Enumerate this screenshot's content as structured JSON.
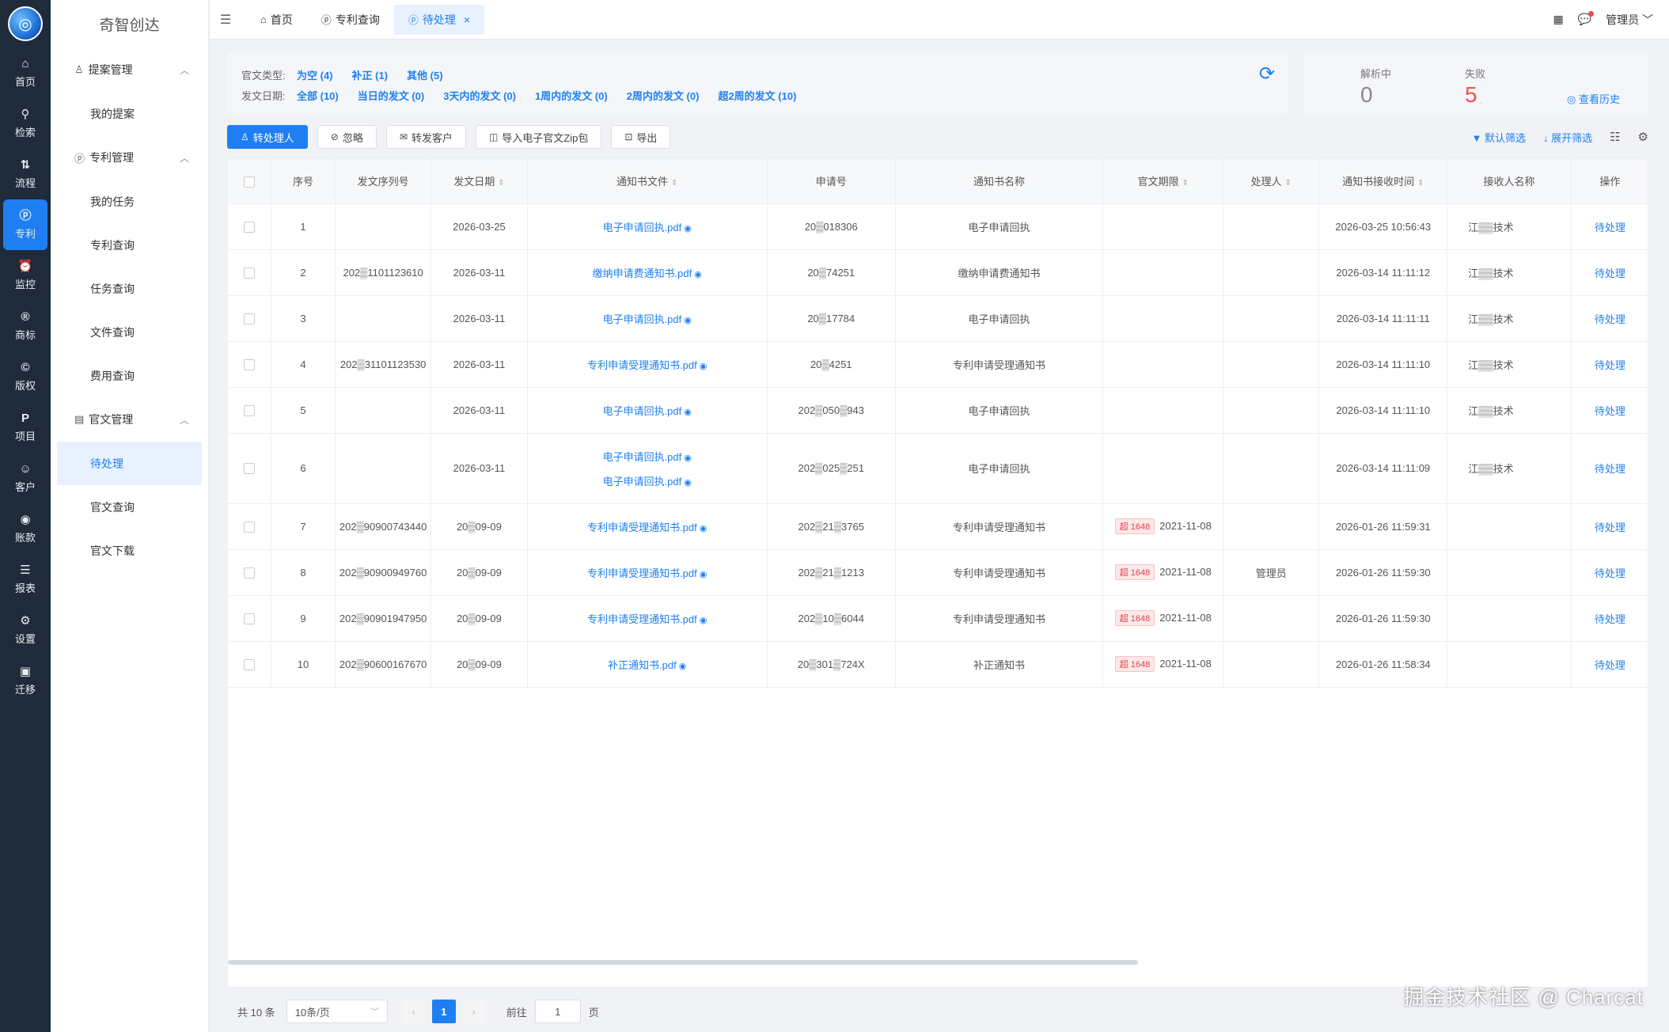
{
  "app": {
    "name": "奇智创达",
    "logo_glyph": "◎"
  },
  "rail": [
    {
      "icon": "⌂",
      "icon_name": "home-icon",
      "label": "首页"
    },
    {
      "icon": "⚲",
      "icon_name": "search-icon",
      "label": "检索"
    },
    {
      "icon": "⇅",
      "icon_name": "flow-icon",
      "label": "流程"
    },
    {
      "icon": "ⓟ",
      "icon_name": "patent-icon",
      "label": "专利"
    },
    {
      "icon": "⏰",
      "icon_name": "alarm-icon",
      "label": "监控"
    },
    {
      "icon": "®",
      "icon_name": "trademark-icon",
      "label": "商标"
    },
    {
      "icon": "©",
      "icon_name": "copyright-icon",
      "label": "版权"
    },
    {
      "icon": "P",
      "icon_name": "project-icon",
      "label": "项目"
    },
    {
      "icon": "☺",
      "icon_name": "user-icon",
      "label": "客户"
    },
    {
      "icon": "◉",
      "icon_name": "account-icon",
      "label": "账款"
    },
    {
      "icon": "☰",
      "icon_name": "report-icon",
      "label": "报表"
    },
    {
      "icon": "⚙",
      "icon_name": "gear-icon",
      "label": "设置"
    },
    {
      "icon": "▣",
      "icon_name": "migrate-icon",
      "label": "迁移"
    }
  ],
  "sidebar": {
    "groups": [
      {
        "icon": "♙",
        "label": "提案管理",
        "chev": "︿",
        "items": [
          "我的提案"
        ]
      },
      {
        "icon": "ⓟ",
        "label": "专利管理",
        "chev": "︿",
        "items": [
          "我的任务",
          "专利查询",
          "任务查询",
          "文件查询",
          "费用查询"
        ]
      },
      {
        "icon": "▤",
        "label": "官文管理",
        "chev": "︿",
        "items": [
          "待处理",
          "官文查询",
          "官文下载"
        ]
      }
    ]
  },
  "topbar": {
    "collapse_glyph": "☰",
    "tabs": [
      {
        "icon": "⌂",
        "label": "首页"
      },
      {
        "icon": "ⓟ",
        "label": "专利查询"
      },
      {
        "icon": "ⓟ",
        "label": "待处理",
        "close": "×"
      }
    ],
    "grid_glyph": "▦",
    "msg_glyph": "💬",
    "user": "管理员 ﹀"
  },
  "filter": {
    "type_label": "官文类型:",
    "types": [
      "为空 (4)",
      "补正 (1)",
      "其他 (5)"
    ],
    "date_label": "发文日期:",
    "dates": [
      "全部 (10)",
      "当日的发文 (0)",
      "3天内的发文 (0)",
      "1周内的发文 (0)",
      "2周内的发文 (0)",
      "超2周的发文 (10)"
    ],
    "refresh_glyph": "⟳"
  },
  "stats": {
    "parsing_label": "解析中",
    "parsing_value": "0",
    "fail_label": "失败",
    "fail_value": "5",
    "history": "◎ 查看历史"
  },
  "toolbar": {
    "buttons": [
      {
        "icon": "♙",
        "label": "转处理人"
      },
      {
        "icon": "⊘",
        "label": "忽略"
      },
      {
        "icon": "✉",
        "label": "转发客户"
      },
      {
        "icon": "◫",
        "label": "导入电子官文Zip包"
      },
      {
        "icon": "⊡",
        "label": "导出"
      }
    ],
    "default_filter": "▼ 默认筛选",
    "expand_filter": "↓ 展开筛选",
    "list_glyph": "☷",
    "settings_glyph": "⚙"
  },
  "table": {
    "headers": [
      "序号",
      "发文序列号",
      "发文日期",
      "通知书文件",
      "申请号",
      "通知书名称",
      "官文期限",
      "处理人",
      "通知书接收时间",
      "接收人名称",
      "操作"
    ],
    "rows": [
      {
        "no": "1",
        "serial": "",
        "date": "2026-03-25",
        "files": [
          "电子申请回执.pdf"
        ],
        "app": "20▒018306",
        "name": "电子申请回执",
        "deadline_badge": "",
        "deadline": "",
        "handler": "",
        "recv": "2026-03-25 10:56:43",
        "receiver": "江▒▒技术",
        "op": "待处理"
      },
      {
        "no": "2",
        "serial": "202▒1101123610",
        "date": "2026-03-11",
        "files": [
          "缴纳申请费通知书.pdf"
        ],
        "app": "20▒74251",
        "name": "缴纳申请费通知书",
        "deadline_badge": "",
        "deadline": "",
        "handler": "",
        "recv": "2026-03-14 11:11:12",
        "receiver": "江▒▒技术",
        "op": "待处理"
      },
      {
        "no": "3",
        "serial": "",
        "date": "2026-03-11",
        "files": [
          "电子申请回执.pdf"
        ],
        "app": "20▒17784",
        "name": "电子申请回执",
        "deadline_badge": "",
        "deadline": "",
        "handler": "",
        "recv": "2026-03-14 11:11:11",
        "receiver": "江▒▒技术",
        "op": "待处理"
      },
      {
        "no": "4",
        "serial": "202▒31101123530",
        "date": "2026-03-11",
        "files": [
          "专利申请受理通知书.pdf"
        ],
        "app": "20▒4251",
        "name": "专利申请受理通知书",
        "deadline_badge": "",
        "deadline": "",
        "handler": "",
        "recv": "2026-03-14 11:11:10",
        "receiver": "江▒▒技术",
        "op": "待处理"
      },
      {
        "no": "5",
        "serial": "",
        "date": "2026-03-11",
        "files": [
          "电子申请回执.pdf"
        ],
        "app": "202▒050▒943",
        "name": "电子申请回执",
        "deadline_badge": "",
        "deadline": "",
        "handler": "",
        "recv": "2026-03-14 11:11:10",
        "receiver": "江▒▒技术",
        "op": "待处理"
      },
      {
        "no": "6",
        "serial": "",
        "date": "2026-03-11",
        "files": [
          "电子申请回执.pdf",
          "电子申请回执.pdf"
        ],
        "app": "202▒025▒251",
        "name": "电子申请回执",
        "deadline_badge": "",
        "deadline": "",
        "handler": "",
        "recv": "2026-03-14 11:11:09",
        "receiver": "江▒▒技术",
        "op": "待处理"
      },
      {
        "no": "7",
        "serial": "202▒90900743440",
        "date": "20▒09-09",
        "files": [
          "专利申请受理通知书.pdf"
        ],
        "app": "202▒21▒3765",
        "name": "专利申请受理通知书",
        "deadline_badge": "超 1648",
        "deadline": "2021-11-08",
        "handler": "",
        "recv": "2026-01-26 11:59:31",
        "receiver": "",
        "op": "待处理"
      },
      {
        "no": "8",
        "serial": "202▒90900949760",
        "date": "20▒09-09",
        "files": [
          "专利申请受理通知书.pdf"
        ],
        "app": "202▒21▒1213",
        "name": "专利申请受理通知书",
        "deadline_badge": "超 1648",
        "deadline": "2021-11-08",
        "handler": "管理员",
        "recv": "2026-01-26 11:59:30",
        "receiver": "",
        "op": "待处理"
      },
      {
        "no": "9",
        "serial": "202▒90901947950",
        "date": "20▒09-09",
        "files": [
          "专利申请受理通知书.pdf"
        ],
        "app": "202▒10▒6044",
        "name": "专利申请受理通知书",
        "deadline_badge": "超 1648",
        "deadline": "2021-11-08",
        "handler": "",
        "recv": "2026-01-26 11:59:30",
        "receiver": "",
        "op": "待处理"
      },
      {
        "no": "10",
        "serial": "202▒90600167670",
        "date": "20▒09-09",
        "files": [
          "补正通知书.pdf"
        ],
        "app": "20▒301▒724X",
        "name": "补正通知书",
        "deadline_badge": "超 1648",
        "deadline": "2021-11-08",
        "handler": "",
        "recv": "2026-01-26 11:58:34",
        "receiver": "",
        "op": "待处理"
      }
    ]
  },
  "pager": {
    "total": "共 10 条",
    "size": "10条/页",
    "size_chev": "﹀",
    "prev": "‹",
    "current": "1",
    "next": "›",
    "goto_label": "前往",
    "goto_value": "1",
    "page_suffix": "页"
  },
  "watermark": "掘金技术社区 @ Charcat",
  "colors": {
    "accent": "#1f7ff2",
    "rail_bg": "#1f2a3a",
    "danger": "#f0524a"
  }
}
